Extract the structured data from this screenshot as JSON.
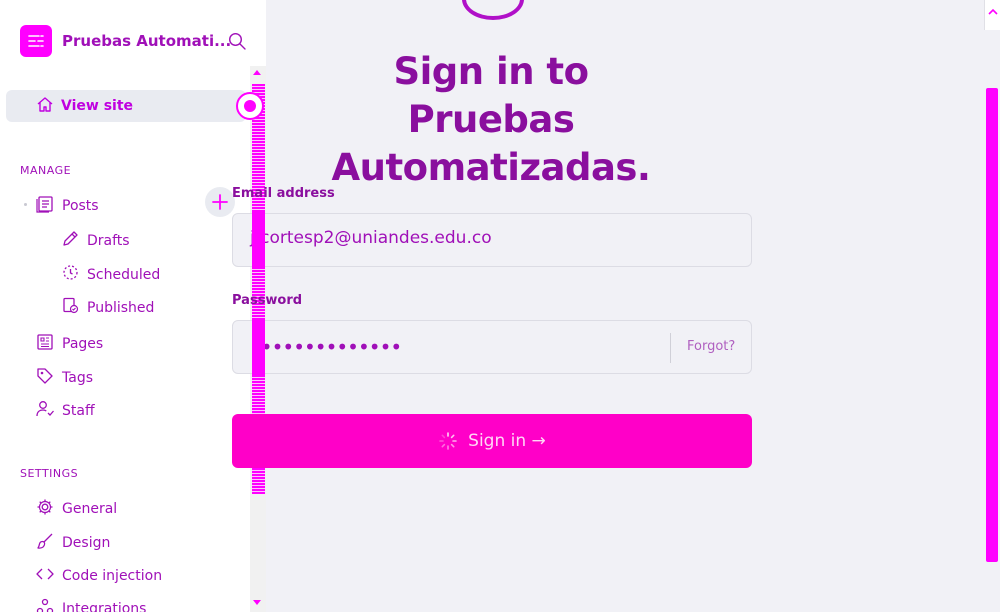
{
  "sidebar": {
    "brand_name": "Pruebas Automati...",
    "active_item": {
      "label": "View site",
      "icon": "home-icon"
    },
    "sections": [
      {
        "title": "MANAGE",
        "items": [
          {
            "label": "Posts",
            "icon": "posts-icon"
          },
          {
            "label": "Drafts",
            "icon": "pencil-icon"
          },
          {
            "label": "Scheduled",
            "icon": "clock-icon"
          },
          {
            "label": "Published",
            "icon": "published-icon"
          },
          {
            "label": "Pages",
            "icon": "pages-icon"
          },
          {
            "label": "Tags",
            "icon": "tag-icon"
          },
          {
            "label": "Staff",
            "icon": "staff-icon"
          }
        ]
      },
      {
        "title": "SETTINGS",
        "items": [
          {
            "label": "General",
            "icon": "gear-icon"
          },
          {
            "label": "Design",
            "icon": "brush-icon"
          },
          {
            "label": "Code injection",
            "icon": "code-icon"
          },
          {
            "label": "Integrations",
            "icon": "integrations-icon"
          }
        ]
      }
    ]
  },
  "login": {
    "heading": "Sign in to Pruebas Automatizadas.",
    "email_label": "Email address",
    "email_value": "j.cortesp2@uniandes.edu.co",
    "password_label": "Password",
    "password_value": "••••••••••••••",
    "forgot_label": "Forgot?",
    "signin_label": "Sign in →"
  },
  "colors": {
    "accent": "#ff00ff",
    "button": "#ff00c8",
    "text": "#8a0f9e"
  }
}
